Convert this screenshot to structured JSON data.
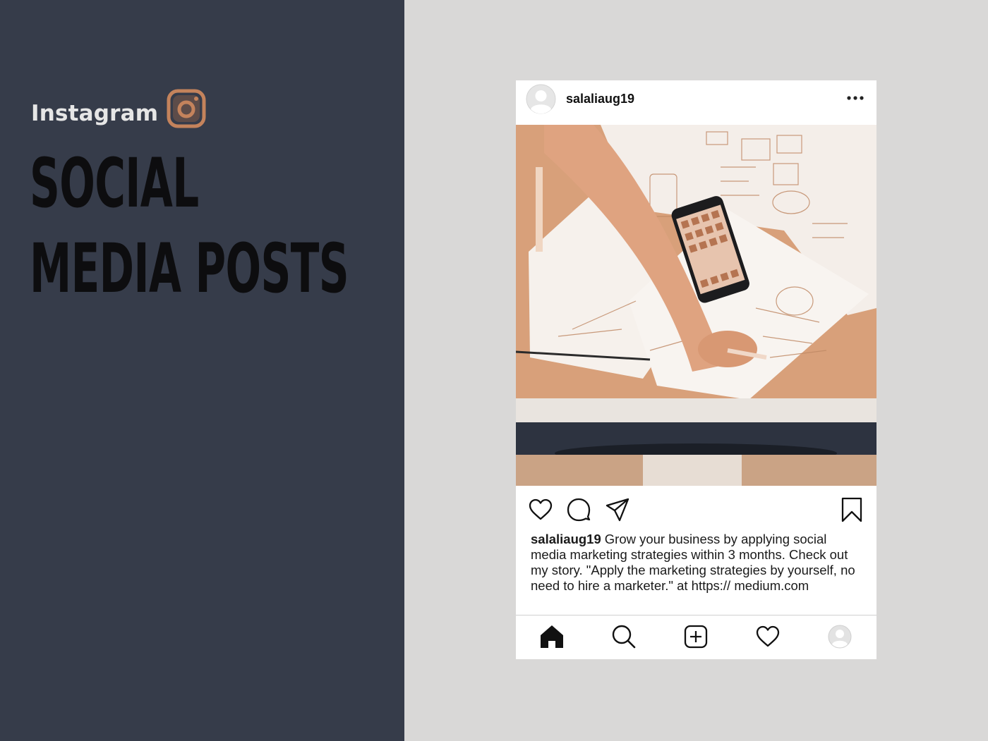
{
  "brand": {
    "label": "Instagram",
    "logo_icon": "instagram-icon",
    "logo_color": "#c4835c"
  },
  "headline": {
    "line1": "SOCIAL",
    "line2": "MEDIA POSTS"
  },
  "post": {
    "username": "salaliaug19",
    "more_icon": "more-horizontal-icon",
    "image_description_icon": "photo",
    "actions": [
      "heart-icon",
      "comment-icon",
      "share-icon",
      "bookmark-icon"
    ],
    "caption_username": "salaliaug19",
    "caption_text": "Grow your business by applying social media marketing strategies within 3 months. Check out my story. \"Apply the marketing strategies by yourself, no need to hire a marketer.\" at https:// medium.com"
  },
  "tabbar": {
    "items": [
      "home-icon",
      "search-icon",
      "add-post-icon",
      "activity-heart-icon",
      "profile-icon"
    ]
  },
  "colors": {
    "left_panel": "#363c4a",
    "right_panel": "#d9d8d7",
    "photo_tint": "#d29a74"
  }
}
